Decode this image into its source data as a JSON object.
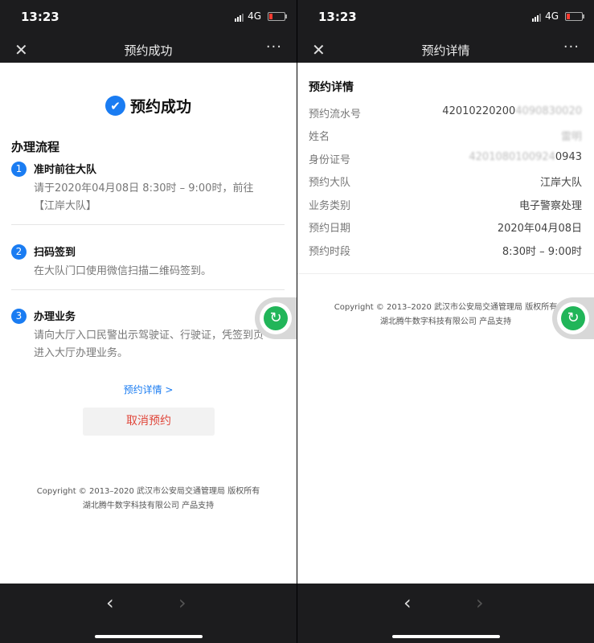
{
  "status": {
    "time": "13:23",
    "network": "4G"
  },
  "left": {
    "nav": {
      "close_icon": "close-icon",
      "title": "预约成功",
      "more": "···"
    },
    "success_title": "预约成功",
    "process_title": "办理流程",
    "steps": [
      {
        "num": "1",
        "title": "准时前往大队",
        "desc": "请于2020年04月08日 8:30时 – 9:00时，前往【江岸大队】"
      },
      {
        "num": "2",
        "title": "扫码签到",
        "desc": "在大队门口使用微信扫描二维码签到。"
      },
      {
        "num": "3",
        "title": "办理业务",
        "desc": "请向大厅入口民警出示驾驶证、行驶证，凭签到页进入大厅办理业务。"
      }
    ],
    "detail_link": "预约详情 >",
    "cancel_button": "取消预约",
    "copyright_line1": "Copyright © 2013–2020 武汉市公安局交通管理局 版权所有",
    "copyright_line2": "湖北腾牛数字科技有限公司 产品支持"
  },
  "right": {
    "nav": {
      "close_icon": "close-icon",
      "title": "预约详情",
      "more": "···"
    },
    "section_title": "预约详情",
    "rows": [
      {
        "label": "预约流水号",
        "value": "42010220200",
        "blurred": "4090830020"
      },
      {
        "label": "姓名",
        "value": "",
        "blurred": "雷明"
      },
      {
        "label": "身份证号",
        "value": "0943",
        "blurred": "4201080100924"
      },
      {
        "label": "预约大队",
        "value": "江岸大队"
      },
      {
        "label": "业务类别",
        "value": "电子警察处理"
      },
      {
        "label": "预约日期",
        "value": "2020年04月08日"
      },
      {
        "label": "预约时段",
        "value": "8:30时 – 9:00时"
      }
    ],
    "copyright_line1": "Copyright © 2013–2020 武汉市公安局交通管理局 版权所有",
    "copyright_line2": "湖北腾牛数字科技有限公司 产品支持"
  },
  "bottom": {
    "back_icon": "chevron-left-icon",
    "forward_icon": "chevron-right-icon"
  },
  "colors": {
    "accent": "#1a7cf2",
    "danger": "#e0463a",
    "float": "#21b559"
  }
}
